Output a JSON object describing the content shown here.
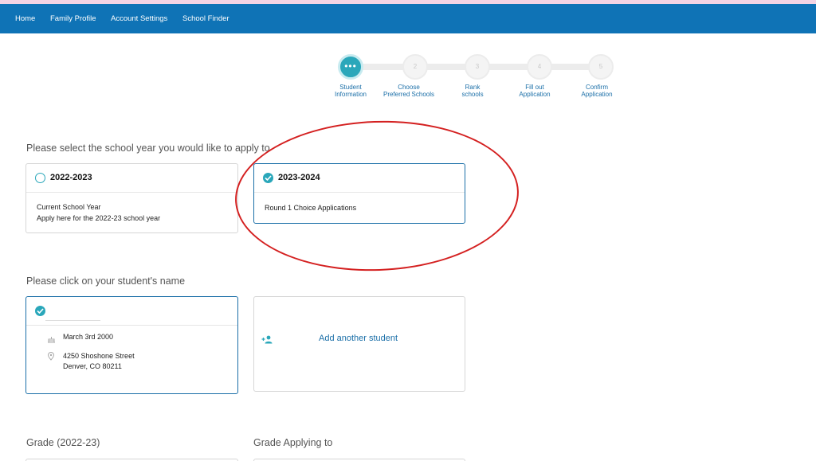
{
  "nav": {
    "items": [
      {
        "label": "Home"
      },
      {
        "label": "Family Profile"
      },
      {
        "label": "Account Settings"
      },
      {
        "label": "School Finder"
      }
    ]
  },
  "stepper": {
    "active_symbol": "•••",
    "steps": [
      {
        "number": "1",
        "label_line1": "Student",
        "label_line2": "Information",
        "state": "active"
      },
      {
        "number": "2",
        "label_line1": "Choose",
        "label_line2": "Preferred Schools",
        "state": "pending"
      },
      {
        "number": "3",
        "label_line1": "Rank",
        "label_line2": "schools",
        "state": "pending"
      },
      {
        "number": "4",
        "label_line1": "Fill out",
        "label_line2": "Application",
        "state": "pending"
      },
      {
        "number": "5",
        "label_line1": "Confirm",
        "label_line2": "Application",
        "state": "pending"
      }
    ]
  },
  "school_year": {
    "prompt": "Please select the school year you would like to apply to",
    "options": [
      {
        "year": "2022-2023",
        "line1": "Current School Year",
        "line2": "Apply here for the 2022-23 school year",
        "selected": false
      },
      {
        "year": "2023-2024",
        "line1": "Round 1 Choice Applications",
        "selected": true
      }
    ]
  },
  "student": {
    "prompt": "Please click on your student's name",
    "name": "",
    "birthdate": "March 3rd 2000",
    "address_line1": "4250 Shoshone Street",
    "address_line2": "Denver, CO 80211",
    "selected": true,
    "add_label": "Add another student"
  },
  "grade": {
    "current_label": "Grade (2022-23)",
    "applying_label": "Grade Applying to"
  },
  "colors": {
    "nav": "#0f73b6",
    "accent": "#2aa7ba",
    "link": "#1b6fa8",
    "annotation": "#d42020"
  }
}
